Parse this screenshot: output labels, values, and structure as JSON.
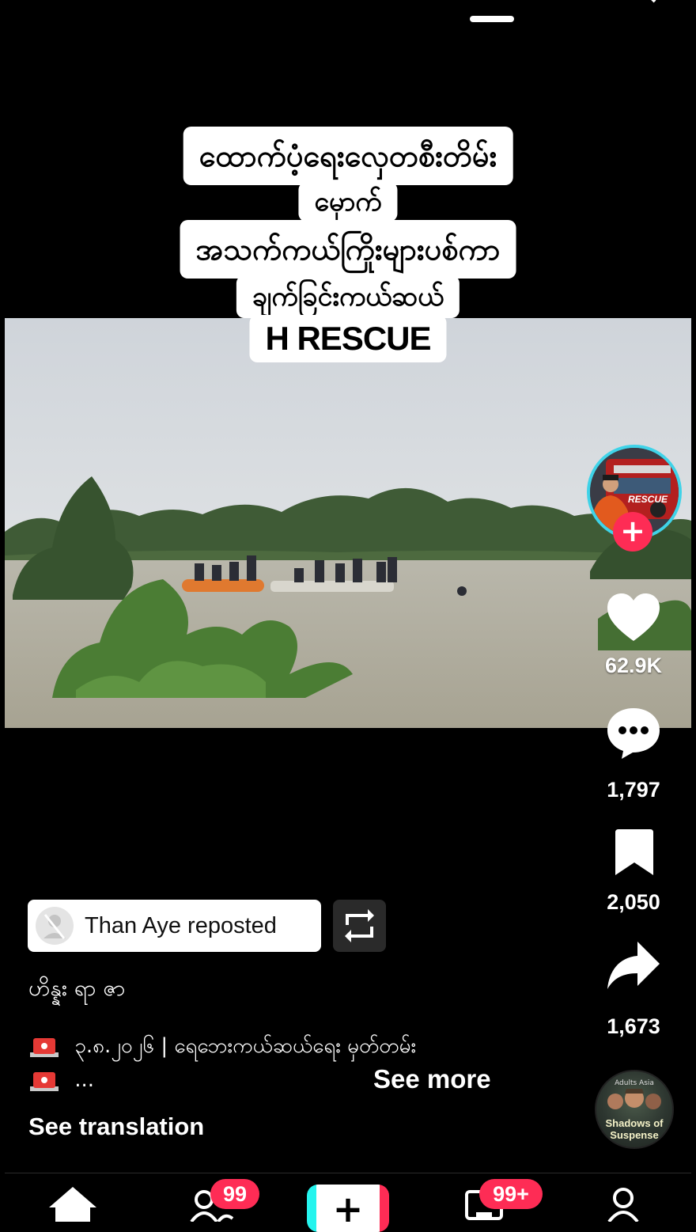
{
  "video_caption": {
    "line1": "ထောက်ပံ့ရေးလှေတစီးတိမ်း",
    "line2": "မှောက်",
    "line3": "အသက်ကယ်ကြိုးများပစ်ကာ",
    "line4": "ချက်ခြင်းကယ်ဆယ်",
    "line5": "H RESCUE"
  },
  "creator": {
    "avatar_icon": "rescue-truck-avatar",
    "avatar_text": "RESCUE",
    "follow_label": "+"
  },
  "actions": {
    "likes": "62.9K",
    "comments": "1,797",
    "bookmarks": "2,050",
    "shares": "1,673"
  },
  "repost": {
    "label": "Than Aye reposted"
  },
  "post": {
    "author": "ဟိန္နး ရာ ဇာ",
    "desc_line1": "၃.၈.၂၀၂၆ | ရေဘေးကယ်ဆယ်ရေး မှတ်တမ်း",
    "desc_line2": "...",
    "see_more": "See more",
    "see_translation": "See translation"
  },
  "music": {
    "label_top": "Adults Asia",
    "label_main": "Shadows of Suspense"
  },
  "nav": {
    "friends_badge": "99",
    "inbox_badge": "99+",
    "create_label": "+"
  },
  "colors": {
    "accent_red": "#fe2c55",
    "accent_cyan": "#25f4ee",
    "avatar_ring": "#3fd3e8"
  }
}
